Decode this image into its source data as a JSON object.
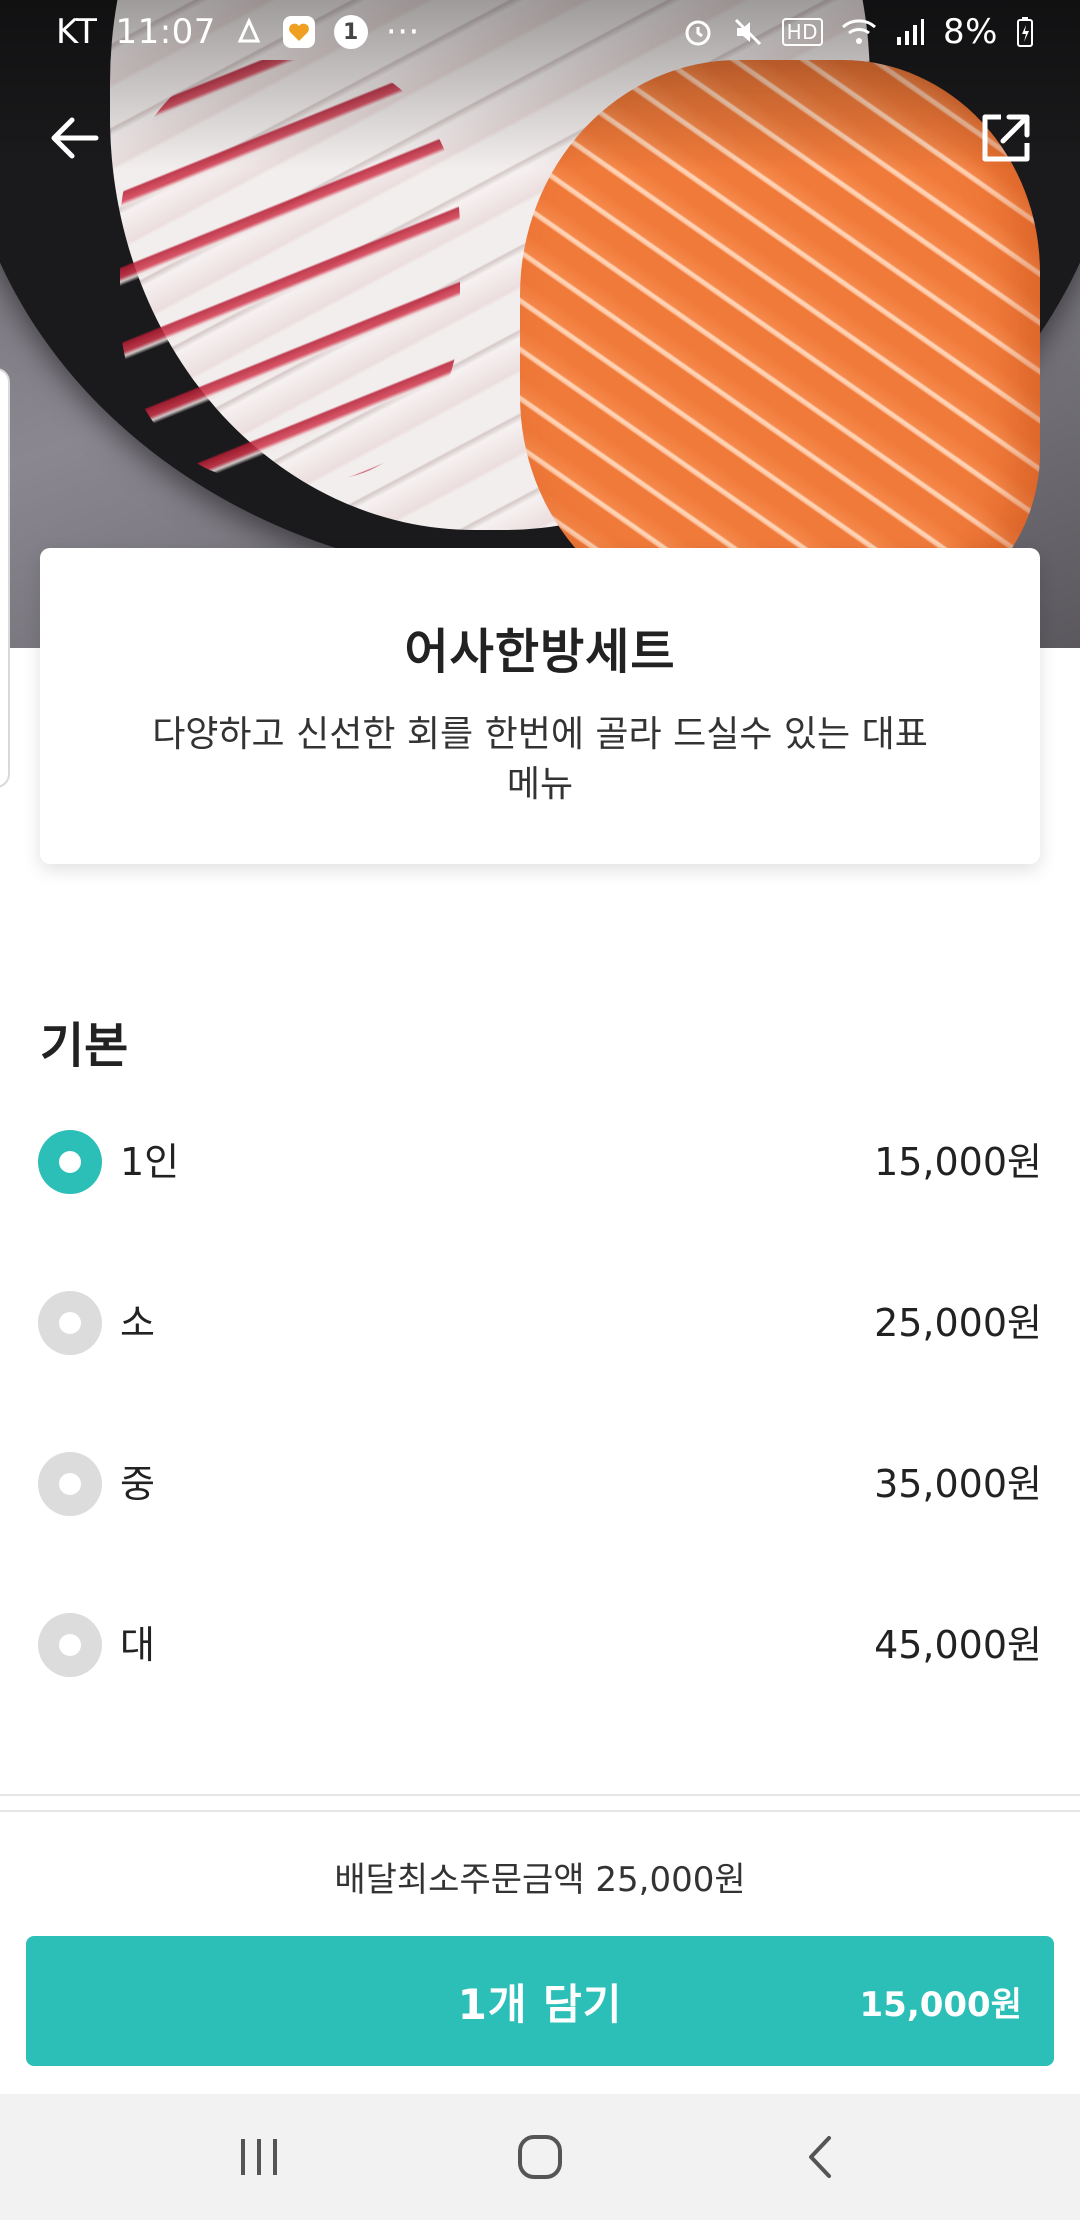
{
  "status_bar": {
    "carrier": "KT",
    "time": "11:07",
    "badge": "1",
    "more": "···",
    "hd": "HD",
    "battery": "8%"
  },
  "menu": {
    "title": "어사한방세트",
    "description": "다양하고 신선한 회를 한번에 골라 드실수 있는 대표메뉴"
  },
  "options_section": {
    "title": "기본",
    "options": [
      {
        "label": "1인",
        "price": "15,000원",
        "selected": true
      },
      {
        "label": "소",
        "price": "25,000원",
        "selected": false
      },
      {
        "label": "중",
        "price": "35,000원",
        "selected": false
      },
      {
        "label": "대",
        "price": "45,000원",
        "selected": false
      }
    ]
  },
  "footer": {
    "min_order": "배달최소주문금액 25,000원",
    "cta_label": "1개 담기",
    "cta_price": "15,000원"
  },
  "colors": {
    "accent": "#2bbfb8",
    "radio_inactive": "#dcdcdc"
  },
  "icons": {
    "back": "back-arrow-icon",
    "share": "share-icon",
    "recents": "recents-icon",
    "home": "home-icon",
    "system_back": "system-back-icon"
  }
}
